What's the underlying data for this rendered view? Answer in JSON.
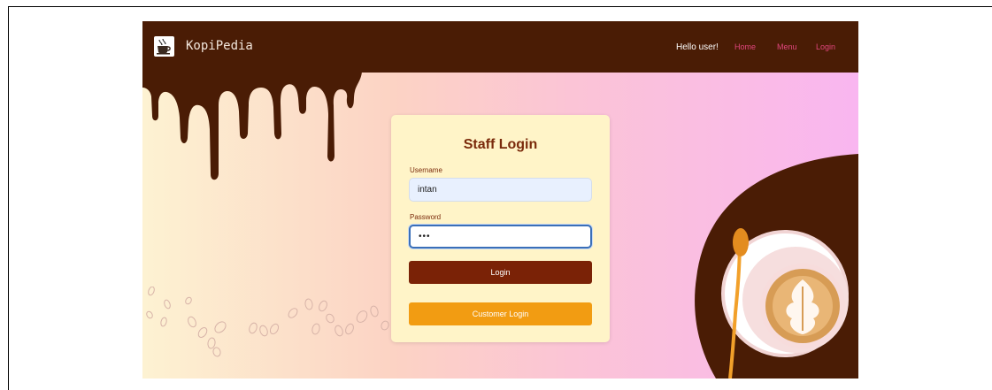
{
  "navbar": {
    "brand": "KopiPedia",
    "greeting": "Hello user!",
    "links": [
      {
        "label": "Home"
      },
      {
        "label": "Menu"
      },
      {
        "label": "Login"
      }
    ]
  },
  "login_card": {
    "title": "Staff Login",
    "username_label": "Username",
    "username_value": "intan",
    "password_label": "Password",
    "password_value": "abc",
    "login_button": "Login",
    "customer_login_button": "Customer Login"
  },
  "colors": {
    "navbar_bg": "#4a1c05",
    "accent_brown": "#7a2206",
    "nav_link": "#e0467d",
    "customer_button": "#f29c12",
    "card_bg": "#fff4c8"
  },
  "icons": {
    "logo": "coffee-cup-icon"
  }
}
